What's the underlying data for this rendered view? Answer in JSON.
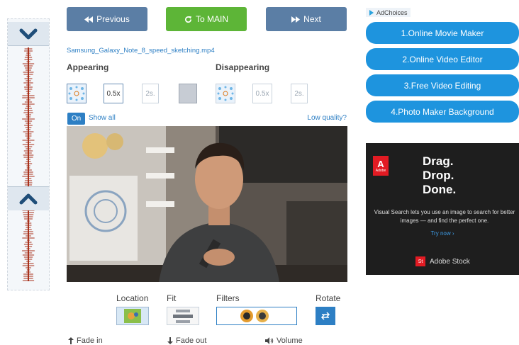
{
  "nav": {
    "previous": "Previous",
    "main": "To MAIN",
    "next": "Next"
  },
  "file": {
    "name": "Samsung_Galaxy_Note_8_speed_sketching.mp4"
  },
  "transitions": {
    "appearing_label": "Appearing",
    "disappearing_label": "Disappearing",
    "appearing": {
      "speed": "0.5x",
      "duration": "2s."
    },
    "disappearing": {
      "speed": "0.5x",
      "duration": "2s."
    }
  },
  "preview": {
    "toggle": "On",
    "show_all": "Show all",
    "low_quality": "Low quality?"
  },
  "tools": {
    "location": "Location",
    "fit": "Fit",
    "filters": "Filters",
    "rotate": "Rotate"
  },
  "bottom": {
    "fade_in": "Fade in",
    "fade_out": "Fade out",
    "volume": "Volume"
  },
  "ads": {
    "adchoices": "AdChoices",
    "links": [
      "1.Online Movie Maker",
      "2.Online Video Editor",
      "3.Free Video Editing",
      "4.Photo Maker Background"
    ],
    "adobe": {
      "logo_text": "Adobe",
      "line1": "Drag.",
      "line2": "Drop.",
      "line3": "Done.",
      "text": "Visual Search lets you use an image to search for better images — and find the perfect one.",
      "cta": "Try now ›",
      "stock_badge": "St",
      "stock": "Adobe Stock"
    }
  },
  "icons": {
    "timeline_down": "chevron-down-icon",
    "timeline_up": "chevron-up-icon",
    "previous": "rewind-icon",
    "main": "refresh-icon",
    "next": "fast-forward-icon",
    "rotate": "rotate-icon",
    "fade_in": "arrow-up-icon",
    "fade_out": "arrow-down-icon",
    "volume": "speaker-icon"
  },
  "colors": {
    "nav_blue": "#5b7ea5",
    "main_green": "#5db537",
    "link_blue": "#2d7fc4",
    "ad_blue": "#1e94de",
    "waveform": "#a8321c"
  }
}
